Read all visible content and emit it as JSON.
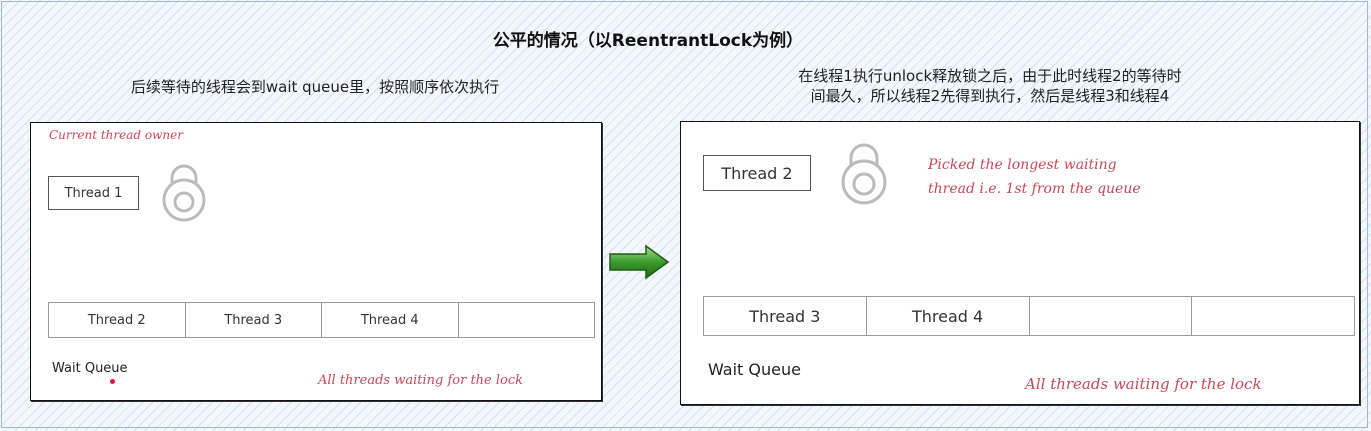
{
  "title": "公平的情况（以ReentrantLock为例）",
  "left": {
    "caption": "后续等待的线程会到wait queue里，按照顺序依次执行",
    "owner_note": "Current thread owner",
    "owner": "Thread 1",
    "queue": [
      "Thread 2",
      "Thread 3",
      "Thread 4",
      ""
    ],
    "queue_label": "Wait Queue",
    "queue_note": "All threads waiting for the lock"
  },
  "right": {
    "caption_line1": "在线程1执行unlock释放锁之后，由于此时线程2的等待时",
    "caption_line2": "间最久，所以线程2先得到执行，然后是线程3和线程4",
    "owner": "Thread 2",
    "pick_note_line1": "Picked the longest waiting",
    "pick_note_line2": "thread i.e. 1st from the queue",
    "queue": [
      "Thread 3",
      "Thread 4",
      "",
      ""
    ],
    "queue_label": "Wait Queue",
    "queue_note": "All threads waiting for the lock"
  },
  "icons": {
    "lock": "lock-icon",
    "arrow": "right-arrow-icon",
    "arrow_color": "#3a9a2c"
  },
  "colors": {
    "annotation": "#c8485a",
    "dot": "#e0143c"
  }
}
